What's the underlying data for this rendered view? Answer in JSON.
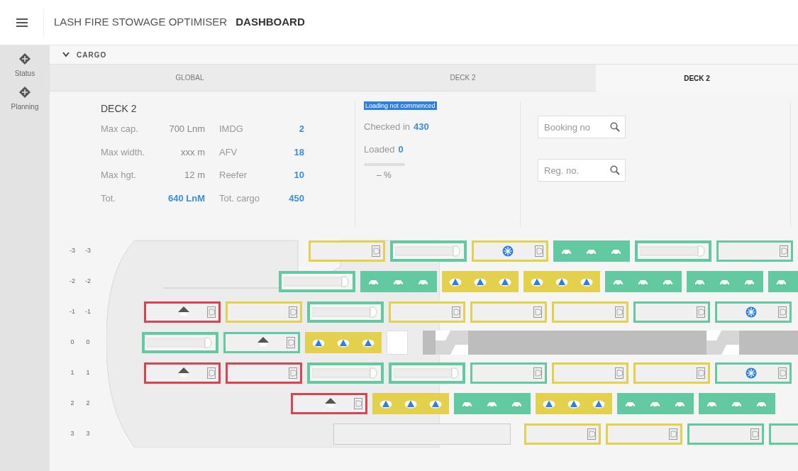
{
  "header": {
    "app_title": "LASH FIRE STOWAGE OPTIMISER",
    "page_title": "DASHBOARD"
  },
  "sidebar": {
    "items": [
      {
        "label": "Status"
      },
      {
        "label": "Planning"
      }
    ]
  },
  "section": {
    "title": "CARGO",
    "expanded": true
  },
  "tabs": [
    {
      "label": "GLOBAL",
      "selected": false
    },
    {
      "label": "DECK 2",
      "selected": false
    },
    {
      "label": "DECK 2",
      "selected": true
    }
  ],
  "deck_info": {
    "title": "DECK 2",
    "stats": [
      {
        "label": "Max cap.",
        "value": "700 Lnm",
        "emphasized": false
      },
      {
        "label": "IMDG",
        "value": "2",
        "emphasized": true
      },
      {
        "label": "Max width.",
        "value": "xxx m",
        "emphasized": false
      },
      {
        "label": "AFV",
        "value": "18",
        "emphasized": true
      },
      {
        "label": "Max hgt.",
        "value": "12 m",
        "emphasized": false
      },
      {
        "label": "Reefer",
        "value": "10",
        "emphasized": true
      },
      {
        "label": "Tot.",
        "value": "640 LnM",
        "emphasized": true
      },
      {
        "label": "Tot. cargo",
        "value": "450",
        "emphasized": true
      }
    ],
    "status_badge": "Loading not commenced",
    "checked_in": {
      "label": "Checked in",
      "value": "430"
    },
    "loaded": {
      "label": "Loaded",
      "value": "0"
    },
    "progress": {
      "level": 0,
      "reading": "– %"
    },
    "searches": [
      {
        "placeholder": "Booking no"
      },
      {
        "placeholder": "Reg. no."
      }
    ]
  },
  "lanes": [
    {
      "labels": [
        "-3",
        "-3"
      ],
      "slots": [
        {
          "kind": "trailer",
          "color": "#e3d04c"
        },
        {
          "kind": "car",
          "color": "#62c9a0"
        },
        {
          "kind": "reefer",
          "color": "#e3d04c"
        },
        {
          "kind": "cars",
          "color": "#62c9a0"
        },
        {
          "kind": "car",
          "color": "#62c9a0"
        },
        {
          "kind": "trailer",
          "color": "#62c9a0"
        }
      ]
    },
    {
      "labels": [
        "-2",
        "-2"
      ],
      "slots": [
        {
          "kind": "car",
          "color": "#62c9a0"
        },
        {
          "kind": "cars",
          "color": "#62c9a0"
        },
        {
          "kind": "hazard",
          "color": "#e3d04c"
        },
        {
          "kind": "hazard",
          "color": "#e3d04c"
        },
        {
          "kind": "cars",
          "color": "#62c9a0"
        },
        {
          "kind": "cars",
          "color": "#62c9a0"
        },
        {
          "kind": "cars",
          "color": "#62c9a0"
        }
      ]
    },
    {
      "labels": [
        "-1",
        "-1"
      ],
      "slots": [
        {
          "kind": "afv",
          "color": "#d9454f"
        },
        {
          "kind": "trailer",
          "color": "#e3d04c"
        },
        {
          "kind": "car",
          "color": "#62c9a0"
        },
        {
          "kind": "trailer",
          "color": "#e3d04c"
        },
        {
          "kind": "trailer",
          "color": "#e3d04c"
        },
        {
          "kind": "trailer",
          "color": "#e3d04c"
        },
        {
          "kind": "trailer",
          "color": "#62c9a0"
        },
        {
          "kind": "reefer",
          "color": "#62c9a0"
        }
      ]
    },
    {
      "labels": [
        "0",
        "0"
      ],
      "slots": [
        {
          "kind": "car",
          "color": "#62c9a0"
        },
        {
          "kind": "afv",
          "color": "#62c9a0"
        },
        {
          "kind": "hazard",
          "color": "#e3d04c"
        },
        {
          "kind": "gap",
          "color": "#dddddd"
        },
        {
          "kind": "ramp",
          "color": "#bdbdbd"
        }
      ]
    },
    {
      "labels": [
        "1",
        "1"
      ],
      "slots": [
        {
          "kind": "afv",
          "color": "#d9454f"
        },
        {
          "kind": "trailer",
          "color": "#d9454f"
        },
        {
          "kind": "car",
          "color": "#62c9a0"
        },
        {
          "kind": "car",
          "color": "#62c9a0"
        },
        {
          "kind": "trailer",
          "color": "#62c9a0"
        },
        {
          "kind": "trailer",
          "color": "#e3d04c"
        },
        {
          "kind": "trailer",
          "color": "#e3d04c"
        },
        {
          "kind": "reefer",
          "color": "#62c9a0"
        }
      ]
    },
    {
      "labels": [
        "2",
        "2"
      ],
      "slots": [
        {
          "kind": "afv",
          "color": "#d9454f"
        },
        {
          "kind": "hazard",
          "color": "#e3d04c"
        },
        {
          "kind": "cars",
          "color": "#62c9a0"
        },
        {
          "kind": "hazard",
          "color": "#e3d04c"
        },
        {
          "kind": "cars",
          "color": "#62c9a0"
        },
        {
          "kind": "cars",
          "color": "#62c9a0"
        }
      ]
    },
    {
      "labels": [
        "3",
        "3"
      ],
      "slots": [
        {
          "kind": "empty",
          "color": "#cccccc"
        },
        {
          "kind": "trailer",
          "color": "#e3d04c"
        },
        {
          "kind": "trailer",
          "color": "#e3d04c"
        },
        {
          "kind": "trailer",
          "color": "#62c9a0"
        },
        {
          "kind": "trailer",
          "color": "#62c9a0"
        }
      ]
    }
  ]
}
